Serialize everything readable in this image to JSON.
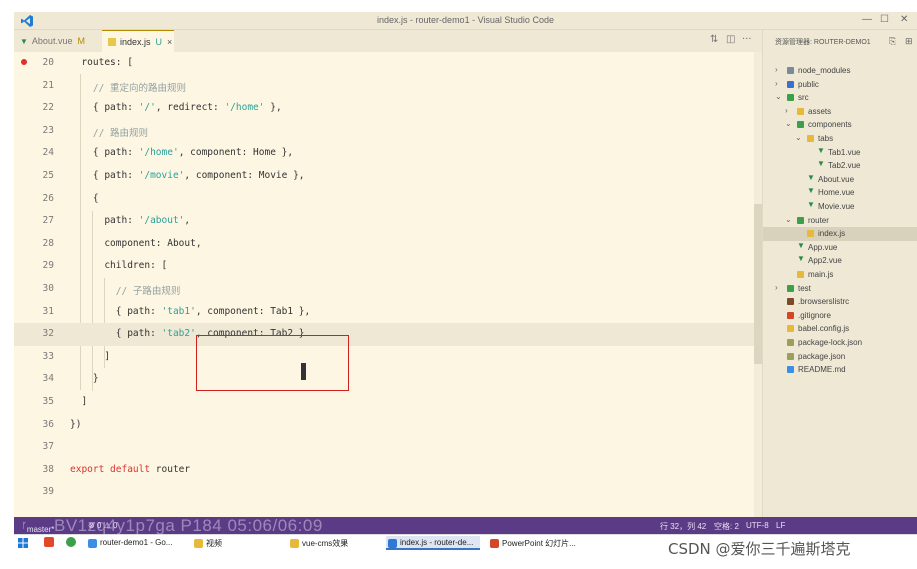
{
  "window": {
    "title": "index.js - router-demo1 - Visual Studio Code"
  },
  "tabs": [
    {
      "label": "About.vue",
      "mark": "M",
      "type": "vue"
    },
    {
      "label": "index.js",
      "mark": "U",
      "type": "js",
      "close": "×"
    }
  ],
  "explorer": {
    "header": "资源管理器: ROUTER-DEMO1",
    "items": [
      {
        "label": "node_modules"
      },
      {
        "label": "public"
      },
      {
        "label": "src"
      },
      {
        "label": "assets"
      },
      {
        "label": "components"
      },
      {
        "label": "tabs"
      },
      {
        "label": "Tab1.vue"
      },
      {
        "label": "Tab2.vue"
      },
      {
        "label": "About.vue"
      },
      {
        "label": "Home.vue"
      },
      {
        "label": "Movie.vue"
      },
      {
        "label": "router"
      },
      {
        "label": "index.js"
      },
      {
        "label": "App.vue"
      },
      {
        "label": "App2.vue"
      },
      {
        "label": "main.js"
      },
      {
        "label": "test"
      },
      {
        "label": ".browserslistrc"
      },
      {
        "label": ".gitignore"
      },
      {
        "label": "babel.config.js"
      },
      {
        "label": "package-lock.json"
      },
      {
        "label": "package.json"
      },
      {
        "label": "README.md"
      }
    ]
  },
  "code_lines": [
    {
      "n": "20",
      "parts": [
        [
          "p",
          "  routes: ["
        ]
      ]
    },
    {
      "n": "21",
      "parts": [
        [
          "c",
          "    // 重定向的路由规则"
        ]
      ]
    },
    {
      "n": "22",
      "parts": [
        [
          "p",
          "    { path: "
        ],
        [
          "s",
          "'/'"
        ],
        [
          "p",
          ", redirect: "
        ],
        [
          "s",
          "'/home'"
        ],
        [
          "p",
          " },"
        ]
      ]
    },
    {
      "n": "23",
      "parts": [
        [
          "c",
          "    // 路由规则"
        ]
      ]
    },
    {
      "n": "24",
      "parts": [
        [
          "p",
          "    { path: "
        ],
        [
          "s",
          "'/home'"
        ],
        [
          "p",
          ", component: Home },"
        ]
      ]
    },
    {
      "n": "25",
      "parts": [
        [
          "p",
          "    { path: "
        ],
        [
          "s",
          "'/movie'"
        ],
        [
          "p",
          ", component: Movie },"
        ]
      ]
    },
    {
      "n": "26",
      "parts": [
        [
          "p",
          "    {"
        ]
      ]
    },
    {
      "n": "27",
      "parts": [
        [
          "p",
          "      path: "
        ],
        [
          "s",
          "'/about'"
        ],
        [
          "p",
          ","
        ]
      ]
    },
    {
      "n": "28",
      "parts": [
        [
          "p",
          "      component: About,"
        ]
      ]
    },
    {
      "n": "29",
      "parts": [
        [
          "p",
          "      children: ["
        ]
      ]
    },
    {
      "n": "30",
      "parts": [
        [
          "c",
          "        // 子路由规则"
        ]
      ]
    },
    {
      "n": "31",
      "parts": [
        [
          "p",
          "        { path: "
        ],
        [
          "s",
          "'tab1'"
        ],
        [
          "p",
          ", component: Tab1 },"
        ]
      ]
    },
    {
      "n": "32",
      "parts": [
        [
          "p",
          "        { path: "
        ],
        [
          "s",
          "'tab2'"
        ],
        [
          "p",
          ", component: Tab2 }"
        ]
      ]
    },
    {
      "n": "33",
      "parts": [
        [
          "p",
          "      ]"
        ]
      ]
    },
    {
      "n": "34",
      "parts": [
        [
          "p",
          "    }"
        ]
      ]
    },
    {
      "n": "35",
      "parts": [
        [
          "p",
          "  ]"
        ]
      ]
    },
    {
      "n": "36",
      "parts": [
        [
          "p",
          "})"
        ]
      ]
    },
    {
      "n": "37",
      "parts": [
        [
          "p",
          ""
        ]
      ]
    },
    {
      "n": "38",
      "parts": [
        [
          "k",
          "export default"
        ],
        [
          "p",
          " router"
        ]
      ]
    },
    {
      "n": "39",
      "parts": [
        [
          "p",
          ""
        ]
      ]
    }
  ],
  "statusbar": {
    "branch": "master*",
    "problems": "⊗ 0 ⚠ 0",
    "position": "行 32，列 42",
    "spaces": "空格: 2",
    "encoding": "UTF-8",
    "eol": "LF"
  },
  "watermark": "BV1zq4y1p7ga P184 05:06/06:09",
  "taskbar": {
    "items": [
      {
        "label": "router-demo1 - Go...",
        "color": "#3a8ee6"
      },
      {
        "label": "视频",
        "color": "#e6b93a"
      },
      {
        "label": "vue-cms效果",
        "color": "#e6b93a"
      },
      {
        "label": "index.js - router-de...",
        "color": "#2d7ad6"
      },
      {
        "label": "PowerPoint 幻灯片...",
        "color": "#d24726"
      }
    ]
  },
  "csdn_caption": "CSDN @爱你三千遍斯塔克"
}
